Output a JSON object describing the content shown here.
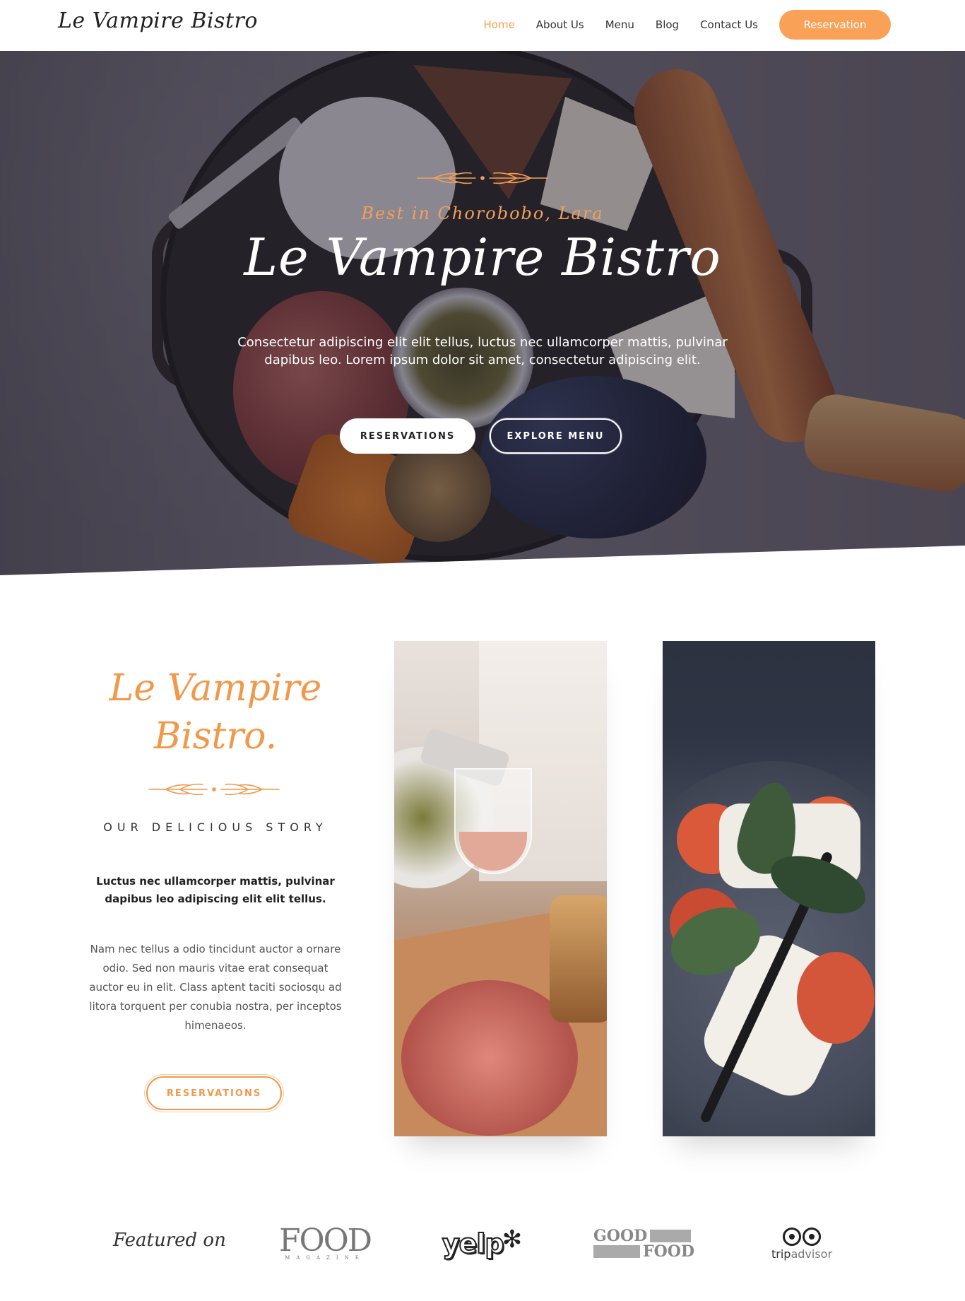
{
  "header": {
    "logo": "Le Vampire Bistro",
    "nav": [
      "Home",
      "About Us",
      "Menu",
      "Blog",
      "Contact Us"
    ],
    "active_nav": "Home",
    "cta": "Reservation"
  },
  "hero": {
    "tagline": "Best in Chorobobo, Lara",
    "title": "Le Vampire Bistro",
    "description": "Consectetur adipiscing elit elit tellus, luctus nec ullamcorper mattis, pulvinar dapibus leo. Lorem ipsum dolor sit amet, consectetur adipiscing elit.",
    "btn_primary": "RESERVATIONS",
    "btn_secondary": "EXPLORE MENU"
  },
  "story": {
    "title_line1": "Le Vampire",
    "title_line2": "Bistro.",
    "kicker": "OUR DELICIOUS STORY",
    "lead": "Luctus nec ullamcorper mattis, pulvinar dapibus leo adipiscing elit elit tellus.",
    "body": "Nam nec tellus a odio tincidunt auctor a ornare odio. Sed non mauris vitae erat consequat auctor eu in elit. Class aptent taciti sociosqu ad litora torquent per conubia nostra, per inceptos himenaeos.",
    "button": "RESERVATIONS"
  },
  "featured": {
    "label": "Featured on",
    "logos": {
      "food_magazine_big": "FOOD",
      "food_magazine_small": "MAGAZINE",
      "yelp": "yelp",
      "goodfood_1": "GOOD",
      "goodfood_2": "FOOD",
      "tripadvisor_a": "trip",
      "tripadvisor_b": "advisor"
    }
  },
  "colors": {
    "accent": "#f9a157",
    "accent_text": "#f2984a",
    "dark": "#222222"
  },
  "icons": {
    "ornament": "wheat-ornament-icon",
    "yelp_burst": "yelp-burst-icon",
    "tripadvisor_owl": "owl-eyes-icon"
  }
}
